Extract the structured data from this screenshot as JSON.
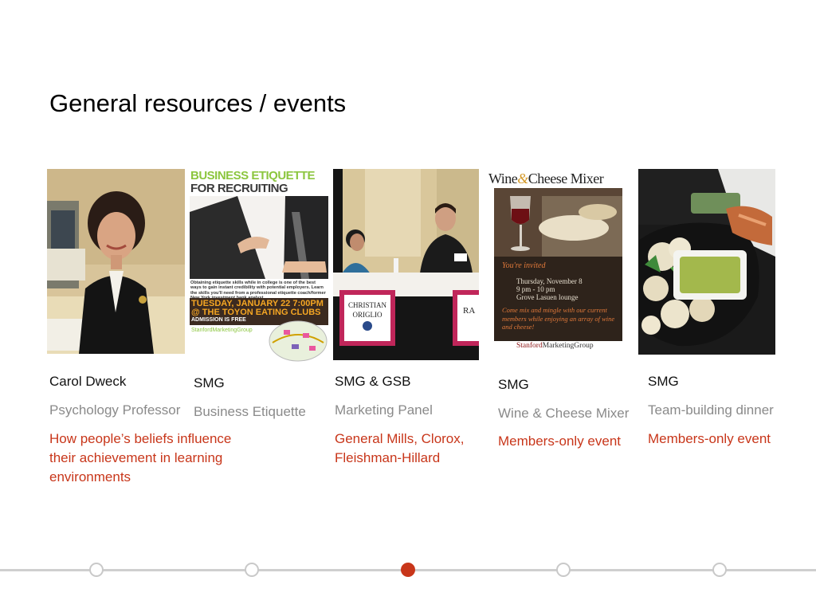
{
  "title": "General resources / events",
  "colors": {
    "accent": "#c8361a",
    "muted": "#8a8a8a",
    "timeline": "#cfcfcf"
  },
  "cards": [
    {
      "who": "Carol Dweck",
      "what": "Psychology Professor",
      "note": "How people’s beliefs influence their achievement in learning environments"
    },
    {
      "who": "SMG",
      "what": "Business Etiquette",
      "note": ""
    },
    {
      "who": "SMG & GSB",
      "what": "Marketing Panel",
      "note": "General Mills, Clorox, Fleishman-Hillard"
    },
    {
      "who": "SMG",
      "what": "Wine & Cheese Mixer",
      "note": "Members-only event"
    },
    {
      "who": "SMG",
      "what": "Team-building dinner",
      "note": "Members-only event"
    }
  ],
  "images": {
    "etiquette_poster": {
      "line1": "BUSINESS ETIQUETTE",
      "line2": "FOR RECRUITING",
      "body": "Obtaining etiquette skills while in college is one of the best ways to gain instant credibility with potential employers. Learn the skills you'll need from a professional etiquette coach/former New York investment bank analyst.",
      "date": "TUESDAY, JANUARY 22 7:00PM",
      "place": "@ THE TOYON EATING CLUBS",
      "admission": "ADMISSION IS FREE",
      "brand": "StanfordMarketingGroup"
    },
    "panel_photo": {
      "placard1a": "CHRISTIAN",
      "placard1b": "ORIGLIO",
      "placard2": "RA"
    },
    "mixer_poster": {
      "title_a": "Wine",
      "title_amp": "&",
      "title_b": "Cheese Mixer",
      "invited": "You're invited",
      "date": "Thursday, November 8",
      "time": "9 pm - 10 pm",
      "venue": "Grove Lasuen lounge",
      "blurb": "Come mix and mingle with our current members while enjoying an array of wine and cheese!",
      "brand_a": "Stanford",
      "brand_b": "MarketingGroup"
    }
  },
  "timeline": {
    "count": 5,
    "active_index": 2
  }
}
